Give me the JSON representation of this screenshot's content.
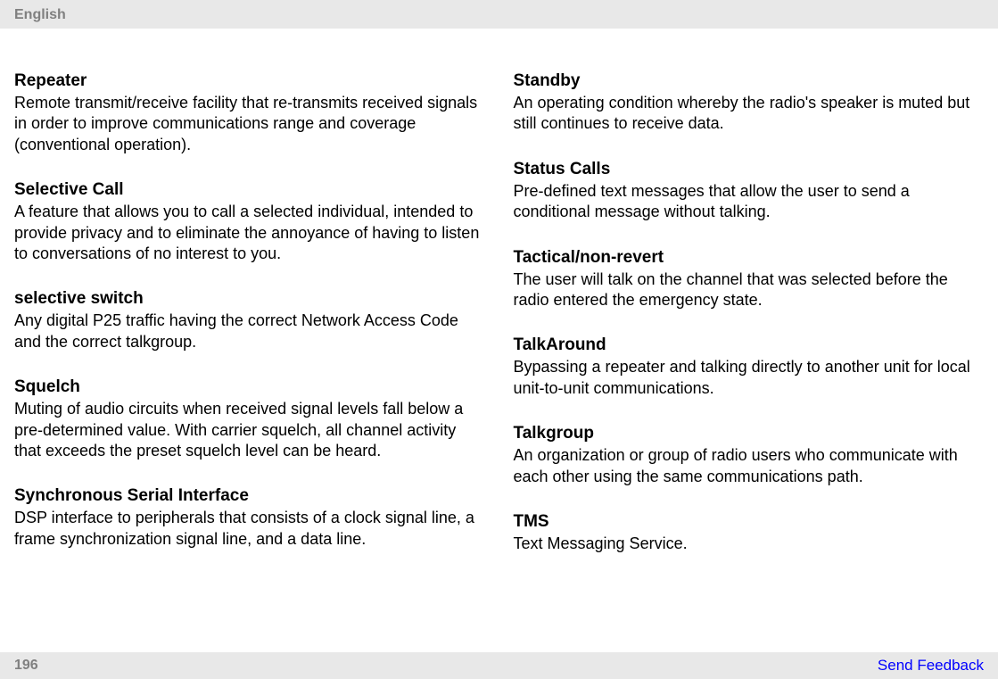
{
  "header": {
    "language": "English"
  },
  "columns": {
    "left": [
      {
        "term": "Repeater",
        "definition": "Remote transmit/receive facility that re-transmits received signals in order to improve communications range and coverage (conventional operation)."
      },
      {
        "term": "Selective Call",
        "definition": "A feature that allows you to call a selected individual, intended to provide privacy and to eliminate the annoyance of having to listen to conversations of no interest to you."
      },
      {
        "term": "selective switch",
        "definition": "Any digital P25 traffic having the correct Network Access Code and the correct talkgroup."
      },
      {
        "term": "Squelch",
        "definition": "Muting of audio circuits when received signal levels fall below a pre-determined value. With carrier squelch, all channel activity that exceeds the preset squelch level can be heard."
      },
      {
        "term": "Synchronous Serial Interface",
        "definition": "DSP interface to peripherals that consists of a clock signal line, a frame synchronization signal line, and a data line."
      }
    ],
    "right": [
      {
        "term": "Standby",
        "definition": "An operating condition whereby the radio's speaker is muted but still continues to receive data."
      },
      {
        "term": "Status Calls",
        "definition": "Pre-defined text messages that allow the user to send a conditional message without talking."
      },
      {
        "term": "Tactical/non-revert",
        "definition": "The user will talk on the channel that was selected before the radio entered the emergency state."
      },
      {
        "term": "TalkAround",
        "definition": "Bypassing a repeater and talking directly to another unit for local unit-to-unit communications."
      },
      {
        "term": "Talkgroup",
        "definition": "An organization or group of radio users who communicate with each other using the same communications path."
      },
      {
        "term": "TMS",
        "definition": "Text Messaging Service."
      }
    ]
  },
  "footer": {
    "page_number": "196",
    "feedback_label": "Send Feedback"
  }
}
